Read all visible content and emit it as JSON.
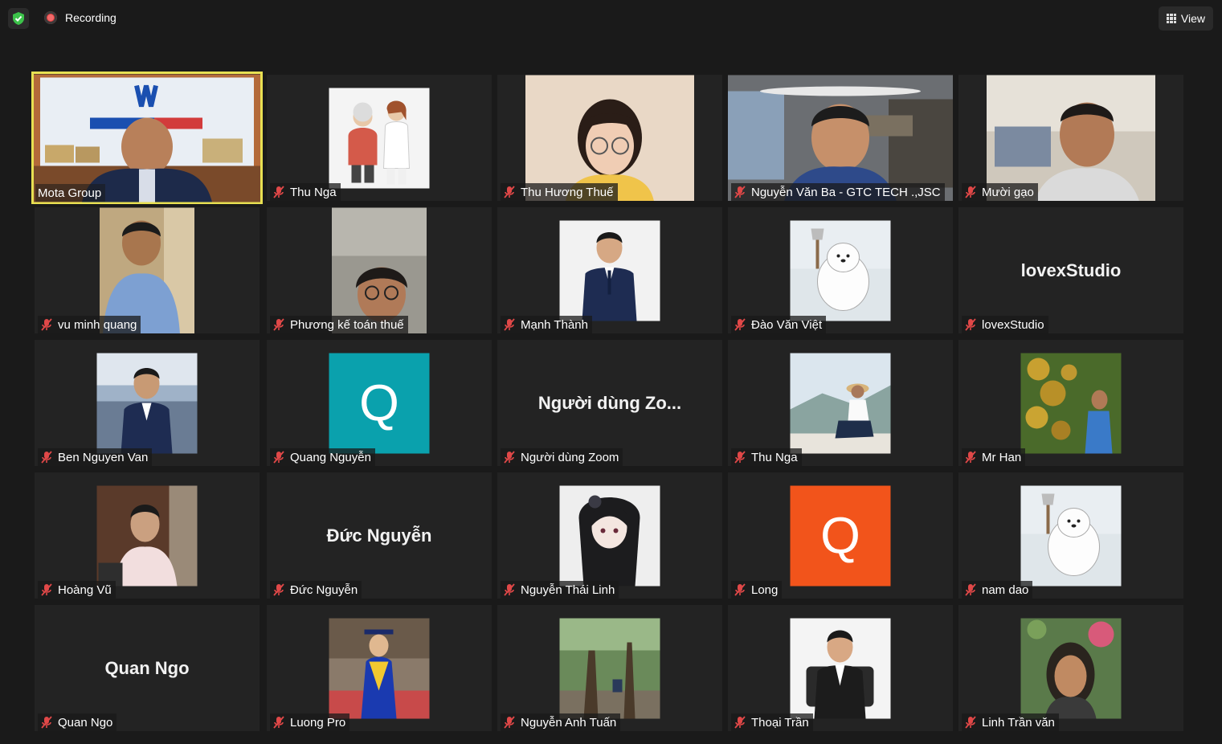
{
  "topbar": {
    "recording_label": "Recording",
    "view_label": "View",
    "shield_color": "#3cc24a",
    "recording_color": "#e03e3e"
  },
  "colors": {
    "active_speaker_border": "#e8e052",
    "muted_icon": "#e04848",
    "tile_bg": "#232323"
  },
  "participants": [
    {
      "name": "Mota Group",
      "muted": false,
      "active": true,
      "video": "photo"
    },
    {
      "name": "Thu Nga",
      "muted": true,
      "video": "photo"
    },
    {
      "name": "Thu Hương Thuế",
      "muted": true,
      "video": "photo"
    },
    {
      "name": "Nguyễn Văn Ba - GTC TECH .,JSC",
      "muted": true,
      "video": "photo"
    },
    {
      "name": "Mười gạo",
      "muted": true,
      "video": "photo"
    },
    {
      "name": "vu minh quang",
      "muted": true,
      "video": "photo"
    },
    {
      "name": "Phương kế toán thuế",
      "muted": true,
      "video": "photo"
    },
    {
      "name": "Mạnh Thành",
      "muted": true,
      "video": "photo"
    },
    {
      "name": "Đào Văn Việt",
      "muted": true,
      "video": "photo"
    },
    {
      "name": "lovexStudio",
      "muted": true,
      "video": "none",
      "display": "lovexStudio"
    },
    {
      "name": "Ben Nguyen Van",
      "muted": true,
      "video": "photo"
    },
    {
      "name": "Quang Nguyễn",
      "muted": true,
      "video": "avatar",
      "avatar_letter": "Q",
      "avatar_color": "#0aa1ad"
    },
    {
      "name": "Người dùng Zoom",
      "muted": true,
      "video": "none",
      "display": "Người dùng Zo..."
    },
    {
      "name": "Thu Nga",
      "muted": true,
      "video": "photo"
    },
    {
      "name": "Mr Han",
      "muted": true,
      "video": "photo"
    },
    {
      "name": "Hoàng Vũ",
      "muted": true,
      "video": "photo"
    },
    {
      "name": "Đức Nguyễn",
      "muted": true,
      "video": "none",
      "display": "Đức Nguyễn"
    },
    {
      "name": "Nguyễn Thái Linh",
      "muted": true,
      "video": "photo"
    },
    {
      "name": "Long",
      "muted": true,
      "video": "avatar",
      "avatar_letter": "Q",
      "avatar_color": "#f2541b"
    },
    {
      "name": "nam dao",
      "muted": true,
      "video": "photo"
    },
    {
      "name": "Quan Ngo",
      "muted": true,
      "video": "none",
      "display": "Quan Ngo"
    },
    {
      "name": "Luong Pro",
      "muted": true,
      "video": "photo"
    },
    {
      "name": "Nguyễn Anh Tuấn",
      "muted": true,
      "video": "photo"
    },
    {
      "name": "Thoại Trần",
      "muted": true,
      "video": "photo"
    },
    {
      "name": "Linh Trần văn",
      "muted": true,
      "video": "photo"
    }
  ]
}
